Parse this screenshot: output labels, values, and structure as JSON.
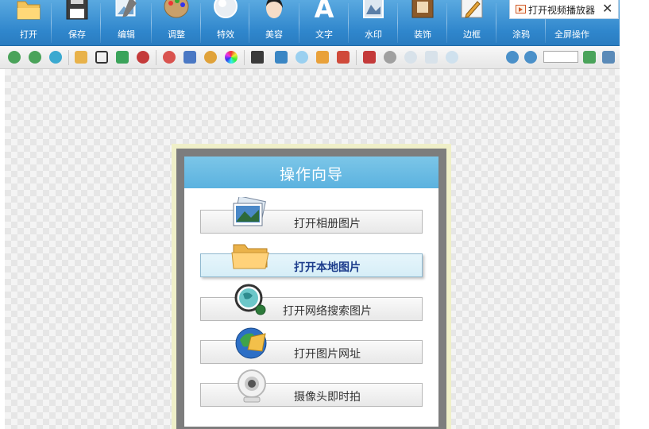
{
  "ribbon": {
    "items": [
      {
        "label": "打开",
        "icon": "folder-icon"
      },
      {
        "label": "保存",
        "icon": "floppy-disk-icon"
      },
      {
        "label": "编辑",
        "icon": "picture-pen-icon"
      },
      {
        "label": "调整",
        "icon": "palette-icon"
      },
      {
        "label": "特效",
        "icon": "magic-orb-icon"
      },
      {
        "label": "美容",
        "icon": "face-icon"
      },
      {
        "label": "文字",
        "icon": "letter-a-icon"
      },
      {
        "label": "水印",
        "icon": "watermark-photo-icon"
      },
      {
        "label": "装饰",
        "icon": "frame-decoration-icon"
      },
      {
        "label": "边框",
        "icon": "border-pencil-icon"
      },
      {
        "label": "涂鸦",
        "icon": "doodle-icon"
      },
      {
        "label": "全屏操作",
        "icon": "fullscreen-icon"
      }
    ]
  },
  "video_player": {
    "label": "打开视频播放器",
    "close_label": "✕"
  },
  "toolbar": {
    "zoom_value": ""
  },
  "dialog": {
    "title": "操作向导",
    "options": [
      {
        "label": "打开相册图片",
        "icon": "photo-album-icon"
      },
      {
        "label": "打开本地图片",
        "icon": "open-folder-icon",
        "selected": true
      },
      {
        "label": "打开网络搜索图片",
        "icon": "globe-search-icon"
      },
      {
        "label": "打开图片网址",
        "icon": "globe-url-icon"
      },
      {
        "label": "摄像头即时拍",
        "icon": "webcam-icon"
      }
    ]
  },
  "colors": {
    "ribbon_top": "#5aa9e0",
    "ribbon_bottom": "#2a7cc0",
    "dialog_header": "#5bb2df",
    "dialog_frame": "#7d7d7d",
    "selected_option_text": "#1d3d8c"
  }
}
